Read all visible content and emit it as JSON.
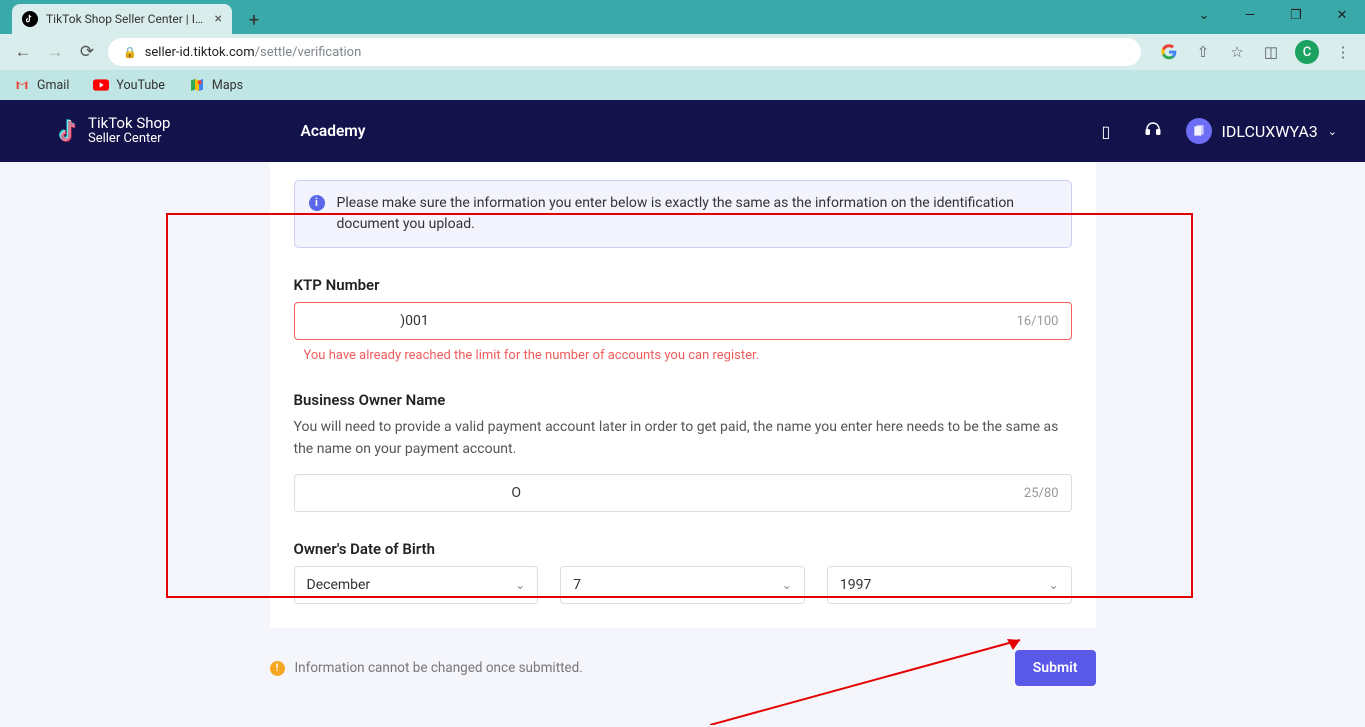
{
  "browser": {
    "tab_title": "TikTok Shop Seller Center | Indon",
    "url_domain": "seller-id.tiktok.com",
    "url_path": "/settle/verification",
    "tab_chevron": "⌄",
    "minimize": "—",
    "maximize": "❐",
    "close": "✕",
    "profile_letter": "C"
  },
  "bookmarks": {
    "gmail": "Gmail",
    "youtube": "YouTube",
    "maps": "Maps"
  },
  "tt_header": {
    "logo_line1_bold": "TikTok",
    "logo_line1_light": " Shop",
    "logo_line2": "Seller Center",
    "nav_academy": "Academy",
    "username": "IDLCUXWYA3"
  },
  "form": {
    "info_text": "Please make sure the information you enter below is exactly the same as the information on the identification document you upload.",
    "ktp_label": "KTP Number",
    "ktp_value": "                           )001",
    "ktp_count": "16/100",
    "ktp_error": "You have already reached the limit for the number of accounts you can register.",
    "owner_label": "Business Owner Name",
    "owner_help": "You will need to provide a valid payment account later in order to get paid, the name you enter here needs to be the same as the name on your payment account.",
    "owner_value": "                                                           O",
    "owner_count": "25/80",
    "dob_label": "Owner's Date of Birth",
    "dob_month": "December",
    "dob_day": "7",
    "dob_year": "1997"
  },
  "footer": {
    "warn_text": "Information cannot be changed once submitted.",
    "submit": "Submit"
  }
}
